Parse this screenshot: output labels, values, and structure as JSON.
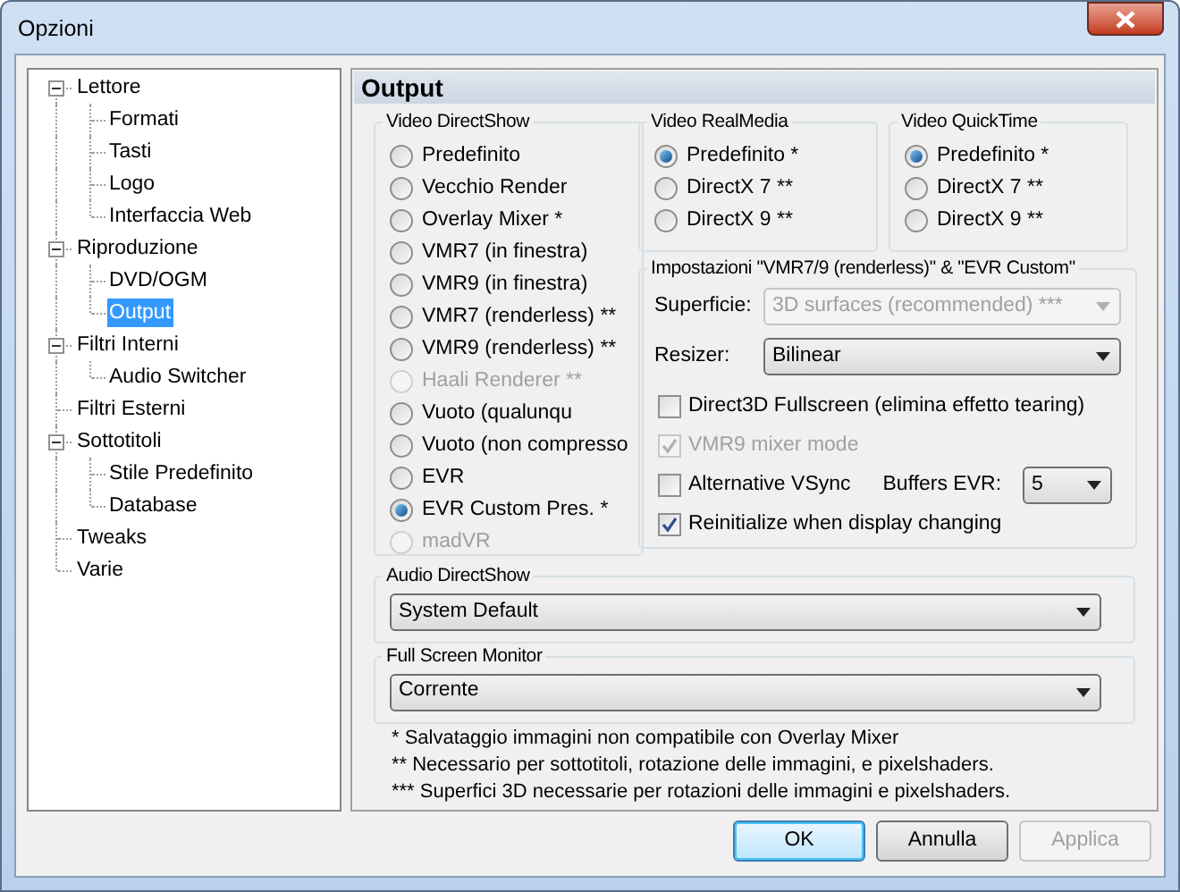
{
  "window": {
    "title": "Opzioni"
  },
  "tree": [
    {
      "label": "Lettore",
      "expanded": true,
      "selected": false,
      "children": [
        {
          "label": "Formati",
          "selected": false
        },
        {
          "label": "Tasti",
          "selected": false
        },
        {
          "label": "Logo",
          "selected": false
        },
        {
          "label": "Interfaccia Web",
          "selected": false
        }
      ]
    },
    {
      "label": "Riproduzione",
      "expanded": true,
      "selected": false,
      "children": [
        {
          "label": "DVD/OGM",
          "selected": false
        },
        {
          "label": "Output",
          "selected": true
        }
      ]
    },
    {
      "label": "Filtri Interni",
      "expanded": true,
      "selected": false,
      "children": [
        {
          "label": "Audio Switcher",
          "selected": false
        }
      ]
    },
    {
      "label": "Filtri Esterni",
      "selected": false
    },
    {
      "label": "Sottotitoli",
      "expanded": true,
      "selected": false,
      "children": [
        {
          "label": "Stile Predefinito",
          "selected": false
        },
        {
          "label": "Database",
          "selected": false
        }
      ]
    },
    {
      "label": "Tweaks",
      "selected": false
    },
    {
      "label": "Varie",
      "selected": false
    }
  ],
  "panel": {
    "title": "Output"
  },
  "video_directshow": {
    "title": "Video DirectShow",
    "options": [
      {
        "label": "Predefinito",
        "selected": false,
        "disabled": false
      },
      {
        "label": "Vecchio Render",
        "selected": false,
        "disabled": false
      },
      {
        "label": "Overlay Mixer *",
        "selected": false,
        "disabled": false
      },
      {
        "label": "VMR7 (in finestra)",
        "selected": false,
        "disabled": false
      },
      {
        "label": "VMR9 (in finestra)",
        "selected": false,
        "disabled": false
      },
      {
        "label": "VMR7 (renderless) **",
        "selected": false,
        "disabled": false
      },
      {
        "label": "VMR9 (renderless) **",
        "selected": false,
        "disabled": false
      },
      {
        "label": "Haali Renderer **",
        "selected": false,
        "disabled": true
      },
      {
        "label": "Vuoto (qualunqu",
        "selected": false,
        "disabled": false
      },
      {
        "label": "Vuoto (non compresso",
        "selected": false,
        "disabled": false
      },
      {
        "label": "EVR",
        "selected": false,
        "disabled": false
      },
      {
        "label": "EVR Custom Pres. *",
        "selected": true,
        "disabled": false
      },
      {
        "label": "madVR",
        "selected": false,
        "disabled": true
      }
    ]
  },
  "video_realmedia": {
    "title": "Video RealMedia",
    "options": [
      {
        "label": "Predefinito *",
        "selected": true,
        "disabled": false
      },
      {
        "label": "DirectX 7 **",
        "selected": false,
        "disabled": false
      },
      {
        "label": "DirectX 9 **",
        "selected": false,
        "disabled": false
      }
    ]
  },
  "video_quicktime": {
    "title": "Video QuickTime",
    "options": [
      {
        "label": "Predefinito *",
        "selected": true,
        "disabled": false
      },
      {
        "label": "DirectX 7 **",
        "selected": false,
        "disabled": false
      },
      {
        "label": "DirectX 9 **",
        "selected": false,
        "disabled": false
      }
    ]
  },
  "renderer_settings": {
    "title": "Impostazioni \"VMR7/9 (renderless)\" & \"EVR Custom\"",
    "dropdowns": [
      {
        "label": "Superficie:",
        "value": "3D surfaces (recommended) ***",
        "disabled": true
      },
      {
        "label": "Resizer:",
        "value": "Bilinear",
        "disabled": false
      }
    ],
    "checkboxes": [
      {
        "label": "Direct3D Fullscreen (elimina effetto tearing)",
        "checked": false,
        "disabled": false
      },
      {
        "label": "VMR9 mixer mode",
        "checked": true,
        "disabled": true
      },
      {
        "label": "Alternative VSync",
        "checked": false,
        "disabled": false,
        "buffers": {
          "label": "Buffers EVR:",
          "value": "5"
        }
      },
      {
        "label": "Reinitialize when display changing",
        "checked": true,
        "disabled": false
      }
    ]
  },
  "audio_directshow": {
    "title": "Audio DirectShow",
    "value": "System Default"
  },
  "full_screen_monitor": {
    "title": "Full Screen Monitor",
    "value": "Corrente"
  },
  "notes": [
    "* Salvataggio immagini non compatibile con Overlay Mixer",
    "** Necessario per sottotitoli, rotazione delle immagini, e pixelshaders.",
    "*** Superfici 3D necessarie per rotazioni delle immagini e pixelshaders."
  ],
  "buttons": [
    {
      "label": "OK",
      "default": true,
      "disabled": false
    },
    {
      "label": "Annulla",
      "default": false,
      "disabled": false
    },
    {
      "label": "Applica",
      "default": false,
      "disabled": true
    }
  ]
}
